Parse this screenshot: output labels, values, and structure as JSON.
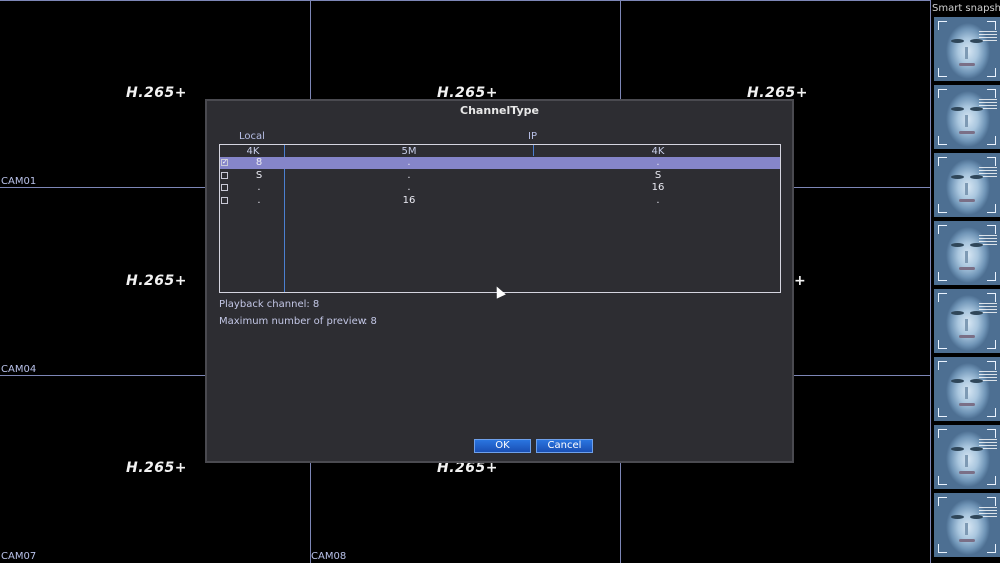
{
  "codec_label": "H.265+",
  "cameras": [
    "CAM01",
    "CAM04",
    "CAM07",
    "CAM08"
  ],
  "snapshot_panel": {
    "title": "Smart snapshot",
    "count": 8
  },
  "dialog": {
    "title": "ChannelType",
    "groups": {
      "local": "Local",
      "ip": "IP"
    },
    "columns": [
      "4K",
      "5M",
      "4K"
    ],
    "rows": [
      {
        "checked": true,
        "local_4k": "8",
        "ip_5m": ".",
        "ip_4k": "."
      },
      {
        "checked": false,
        "local_4k": "S",
        "ip_5m": ".",
        "ip_4k": "S"
      },
      {
        "checked": false,
        "local_4k": ".",
        "ip_5m": ".",
        "ip_4k": "16"
      },
      {
        "checked": false,
        "local_4k": ".",
        "ip_5m": "16",
        "ip_4k": "."
      }
    ],
    "playback_label": "Playback channel: 8",
    "preview_label": "Maximum number of preview",
    "preview_value": ": 8",
    "ok_label": "OK",
    "cancel_label": "Cancel"
  },
  "colors": {
    "grid": "#7d86b6",
    "selected_row": "#8585c9",
    "button": "#1f5fc8"
  }
}
